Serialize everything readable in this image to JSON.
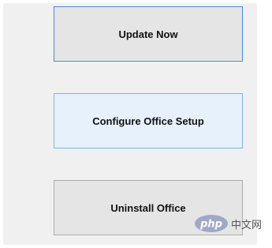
{
  "buttons": {
    "update_now": "Update Now",
    "configure_office_setup": "Configure Office Setup",
    "uninstall_office": "Uninstall Office"
  },
  "watermark": {
    "logo_text": "php",
    "site_text": "中文网"
  },
  "colors": {
    "focus_border": "#3c8fdc",
    "hover_background": "#e6f1fc",
    "panel_background": "#f0f0f0"
  }
}
